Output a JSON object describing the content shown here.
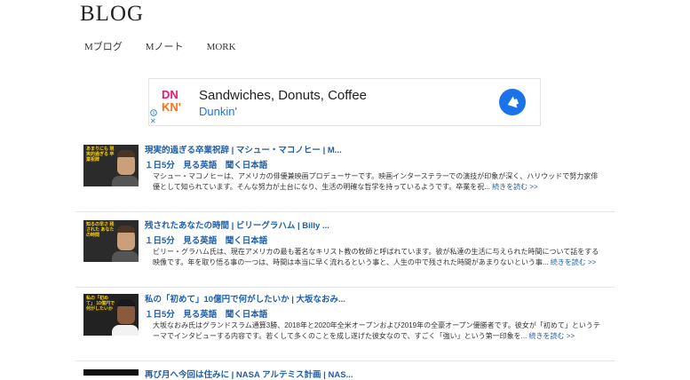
{
  "site": {
    "logo": "BLOG"
  },
  "nav": {
    "items": [
      "Mブログ",
      "Mノート",
      "MORK"
    ]
  },
  "ad": {
    "logo_line1": "DN",
    "logo_line2": "KN'",
    "headline": "Sandwiches, Donuts, Coffee",
    "brand": "Dunkin'",
    "close_label": "✕",
    "colors": {
      "pink": "#e8176f",
      "orange": "#ff6e1a",
      "blue": "#1a73e8"
    }
  },
  "posts": [
    {
      "thumb_caption": "あまりにも 現実的過ぎる 卒業祝辞",
      "title": "現実的過ぎる卒業祝辞 | マシュー・マコノヒー | M...",
      "subtitle": "１日5分　見る英語　聞く日本語",
      "excerpt": "マシュー・マコノヒーは、アメリカの俳優兼映画プロデューサーです。映画インターステラーでの演技が印象が深く、ハリウッドで努力家俳優として知られています。そんな努力が土台になり、生活の明確な哲学を持っているようです。卒業を祝...",
      "more": "続きを読む >>"
    },
    {
      "thumb_caption": "知るの早さ 残された あなたの時間",
      "title": "残されたあなたの時間 | ビリーグラハム | Billy ...",
      "subtitle": "１日5分　見る英語　聞く日本語",
      "excerpt": "ビリー・グラハム氏は、現在アメリカの最も著名なキリスト教の牧師と呼ばれています。彼が私達の生活に与えられた時間について話をする映像です。年を取り悟る事の一つは、時間は本当に早く流れるという事と、人生の中で残された時間があまりないという事...",
      "more": "続きを読む >>"
    },
    {
      "thumb_caption": "私の「初めて」 10億円で 何がしたいか",
      "title": "私の「初めて」10億円で何がしたいか | 大坂なおみ...",
      "subtitle": "１日5分　見る英語　聞く日本語",
      "excerpt": "大坂なおみ氏はグランドスラム通算3勝、2018年と2020年全米オープンおよび2019年の全豪オープン優勝者です。彼女が「初めて」というテーマでインタビューする内容です。若くして多くのことを成し遂げた彼女なので、すごく「強い」という第一印象を...",
      "more": "続きを読む >>"
    },
    {
      "thumb_caption": "",
      "title": "再び月へ今回は住みに | NASA アルテミス計画 | NAS...",
      "subtitle": "",
      "excerpt": "",
      "more": ""
    }
  ]
}
